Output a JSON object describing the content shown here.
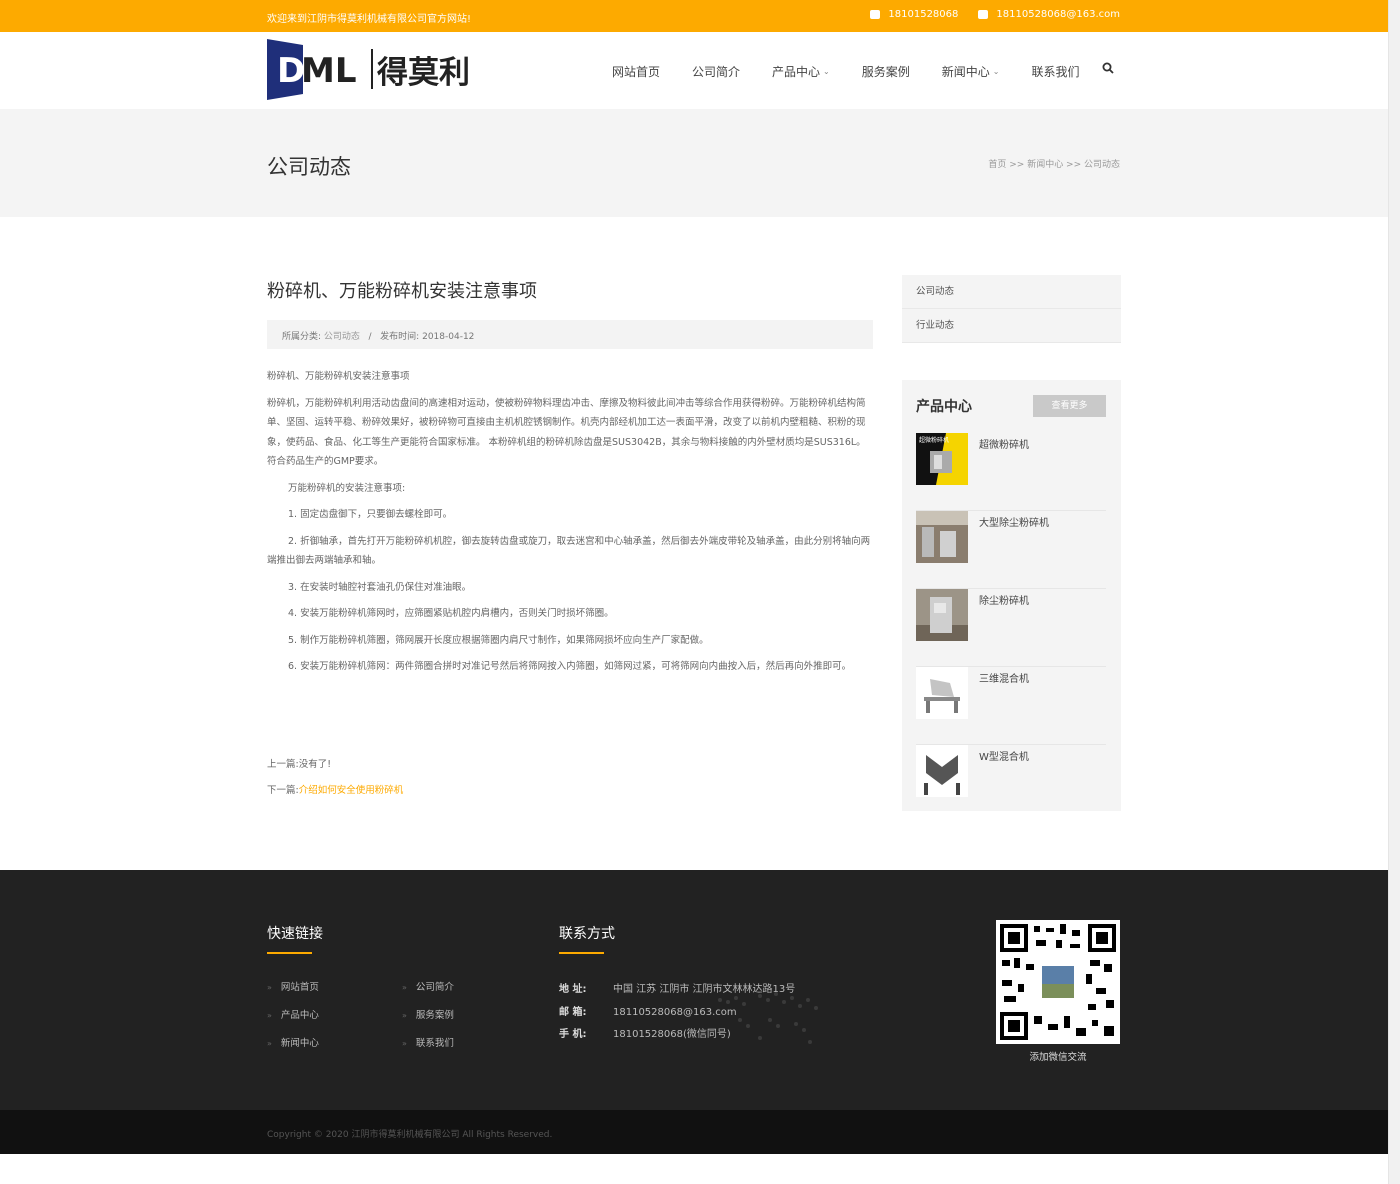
{
  "topbar": {
    "welcome": "欢迎来到江阴市得莫利机械有限公司官方网站!",
    "phone": "18101528068",
    "email": "18110528068@163.com"
  },
  "logo": {
    "text": "DML得莫利"
  },
  "nav": {
    "items": [
      "网站首页",
      "公司简介",
      "产品中心",
      "服务案例",
      "新闻中心",
      "联系我们"
    ]
  },
  "page_header": {
    "title": "公司动态",
    "breadcrumb": "首页 >> 新闻中心 >> 公司动态"
  },
  "article": {
    "title": "粉碎机、万能粉碎机安装注意事项",
    "category_label": "所属分类:",
    "category": "公司动态",
    "sep": "/",
    "date_label": "发布时间:",
    "date": "2018-04-12",
    "paragraphs": [
      "粉碎机、万能粉碎机安装注意事项",
      "粉碎机，万能粉碎机利用活动齿盘间的高速相对运动，使被粉碎物料理齿冲击、摩擦及物料彼此间冲击等综合作用获得粉碎。万能粉碎机结构简单、坚固、运转平稳、粉碎效果好，被粉碎物可直接由主机机腔锈钢制作。机壳内部经机加工达一表面平滑，改变了以前机内壁粗糙、积粉的现象，使药品、食品、化工等生产更能符合国家标准。 本粉碎机组的粉碎机除齿盘是SUS3042B，其余与物料接触的内外壁材质均是SUS316L。符合药品生产的GMP要求。",
      "万能粉碎机的安装注意事项:",
      "1. 固定齿盘御下，只要御去螺栓即可。",
      "2. 折御轴承，首先打开万能粉碎机机腔，御去旋转齿盘或旋刀，取去迷宫和中心轴承盖，然后御去外端皮带轮及轴承盖，由此分别将轴向两端推出御去两端轴承和轴。",
      "3. 在安装时轴腔衬套油孔仍保住对准油眼。",
      "4. 安装万能粉碎机筛网时，应筛圈紧贴机腔内肩槽内，否则关门时损坏筛圈。",
      "5. 制作万能粉碎机筛圈，筛网展开长度应根据筛圈内肩尺寸制作，如果筛网损坏应向生产厂家配做。",
      "6. 安装万能粉碎机筛网：两件筛圈合拼时对准记号然后将筛网按入内筛圈，如筛网过紧，可将筛网向内曲按入后，然后再向外推即可。"
    ],
    "prev_label": "上一篇:",
    "prev": "没有了!",
    "next_label": "下一篇:",
    "next": "介绍如何安全使用粉碎机"
  },
  "sidebar": {
    "categories": [
      "公司动态",
      "行业动态"
    ],
    "products_title": "产品中心",
    "more_button": "查看更多",
    "products": [
      "超微粉碎机",
      "大型除尘粉碎机",
      "除尘粉碎机",
      "三维混合机",
      "W型混合机"
    ],
    "thumb_text": "超微粉碎机"
  },
  "footer": {
    "links_title": "快速链接",
    "links": [
      "网站首页",
      "公司简介",
      "产品中心",
      "服务案例",
      "新闻中心",
      "联系我们"
    ],
    "link_arrow": "»",
    "contact_title": "联系方式",
    "address_label": "地 址:",
    "address": "中国 江苏 江阴市 江阴市文林林达路13号",
    "email_label": "邮 箱:",
    "email": "18110528068@163.com",
    "mobile_label": "手 机:",
    "mobile": "18101528068(微信同号)",
    "qr_caption": "添加微信交流"
  },
  "copyright": "Copyright © 2020 江阴市得莫利机械有限公司 All Rights Reserved.",
  "colors": {
    "accent": "#fdaa00",
    "footer_bg": "#222222",
    "logo_blue": "#1f2f7a"
  }
}
